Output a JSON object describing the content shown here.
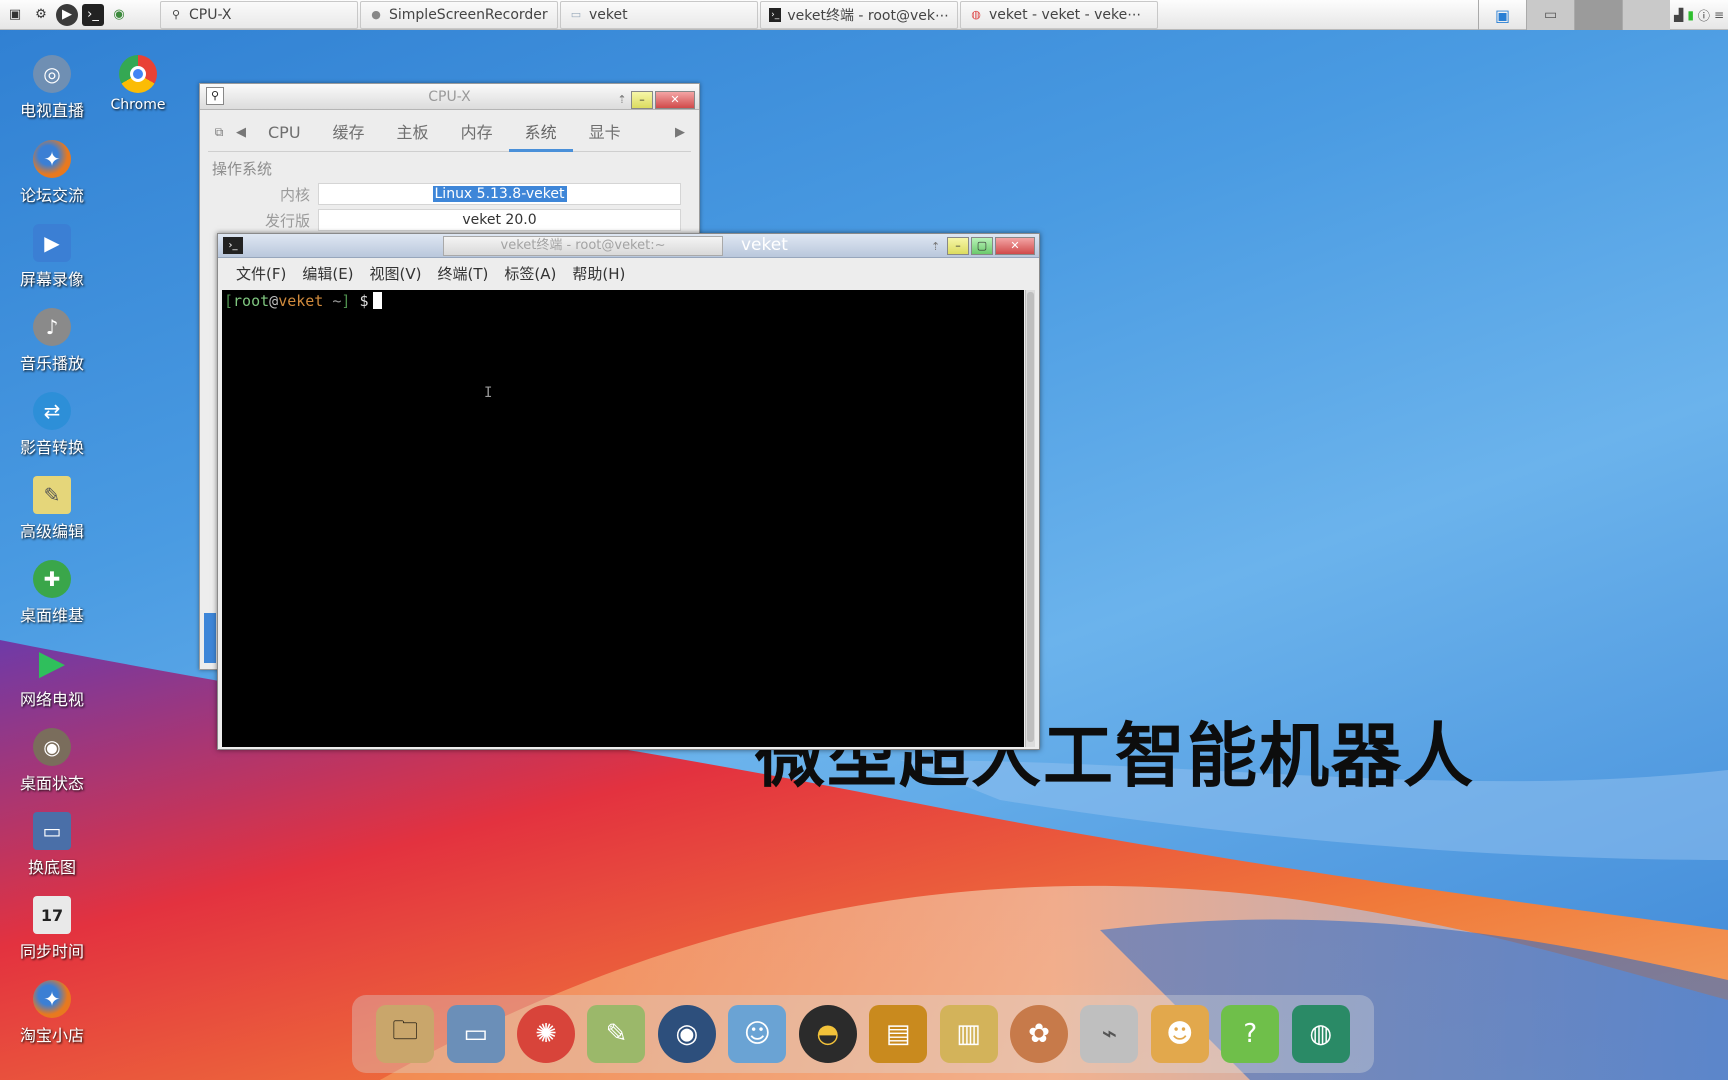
{
  "taskbar": {
    "launcher_icons": [
      "desktop-icon",
      "settings-icon",
      "play-icon",
      "terminal-icon",
      "network-icon"
    ],
    "tasks": [
      {
        "label": "CPU-X",
        "icon": "cpux-icon"
      },
      {
        "label": "SimpleScreenRecorder",
        "icon": "recorder-icon"
      },
      {
        "label": "veket",
        "icon": "folder-icon"
      },
      {
        "label": "veket终端 - root@vek⋯",
        "icon": "terminal-icon"
      },
      {
        "label": "veket - veket - veke⋯",
        "icon": "chrome-icon"
      }
    ]
  },
  "desktop_icons": [
    {
      "label": "电视直播",
      "icon": "tv-icon",
      "color": "#6f8fb3"
    },
    {
      "label": "Chrome",
      "icon": "chrome-icon",
      "color": "#e94235"
    },
    {
      "label": "论坛交流",
      "icon": "firefox-icon",
      "color": "#e8791f"
    },
    {
      "label": "屏幕录像",
      "icon": "screen-record-icon",
      "color": "#3b7fd4"
    },
    {
      "label": "音乐播放",
      "icon": "speaker-icon",
      "color": "#8a8a8a"
    },
    {
      "label": "影音转换",
      "icon": "media-convert-icon",
      "color": "#2d8fd8"
    },
    {
      "label": "高级编辑",
      "icon": "editor-icon",
      "color": "#e5d67a"
    },
    {
      "label": "桌面维基",
      "icon": "wiki-icon",
      "color": "#3aa64a"
    },
    {
      "label": "网络电视",
      "icon": "play-icon",
      "color": "#2f9e5c"
    },
    {
      "label": "桌面状态",
      "icon": "status-icon",
      "color": "#7a6d5c"
    },
    {
      "label": "换底图",
      "icon": "monitor-icon",
      "color": "#4a6fa8"
    },
    {
      "label": "同步时间",
      "icon": "calendar-icon",
      "color": "#e9e9e9"
    },
    {
      "label": "淘宝小店",
      "icon": "firefox-icon",
      "color": "#e8791f"
    }
  ],
  "cpux": {
    "title": "CPU-X",
    "tabs": [
      "CPU",
      "缓存",
      "主板",
      "内存",
      "系统",
      "显卡"
    ],
    "active_tab": "系统",
    "section": "操作系统",
    "rows": [
      {
        "key": "内核",
        "value": "Linux 5.13.8-veket"
      },
      {
        "key": "发行版",
        "value": "veket 20.0"
      }
    ]
  },
  "terminal": {
    "title": "veket终端 - root@veket:~",
    "title_right": "veket",
    "menu": [
      "文件(F)",
      "编辑(E)",
      "视图(V)",
      "终端(T)",
      "标签(A)",
      "帮助(H)"
    ],
    "prompt": {
      "open": "[",
      "user": "root",
      "at": "@",
      "host": "veket",
      "dir": " ~",
      "close": "]",
      "dollar": "$"
    }
  },
  "overlay_text": "微型超人工智能机器人",
  "dock_icons": [
    {
      "icon": "files-icon",
      "color": "#c9a66b"
    },
    {
      "icon": "monitor-icon",
      "color": "#6b8fb8"
    },
    {
      "icon": "hedgehog-icon",
      "color": "#d8443a"
    },
    {
      "icon": "paint-icon",
      "color": "#9bb86a"
    },
    {
      "icon": "media-player-icon",
      "color": "#2d4f7c"
    },
    {
      "icon": "users-icon",
      "color": "#6aa3d4"
    },
    {
      "icon": "penguin-icon",
      "color": "#2b2b2b"
    },
    {
      "icon": "notebook-icon",
      "color": "#c98a1e"
    },
    {
      "icon": "chart-icon",
      "color": "#d3b35a"
    },
    {
      "icon": "palette-icon",
      "color": "#c77a4a"
    },
    {
      "icon": "usb-icon",
      "color": "#bfbfbf"
    },
    {
      "icon": "mascot-icon",
      "color": "#e2a84c"
    },
    {
      "icon": "help-icon",
      "color": "#6fbf4a"
    },
    {
      "icon": "camera-icon",
      "color": "#2a8a66"
    }
  ]
}
